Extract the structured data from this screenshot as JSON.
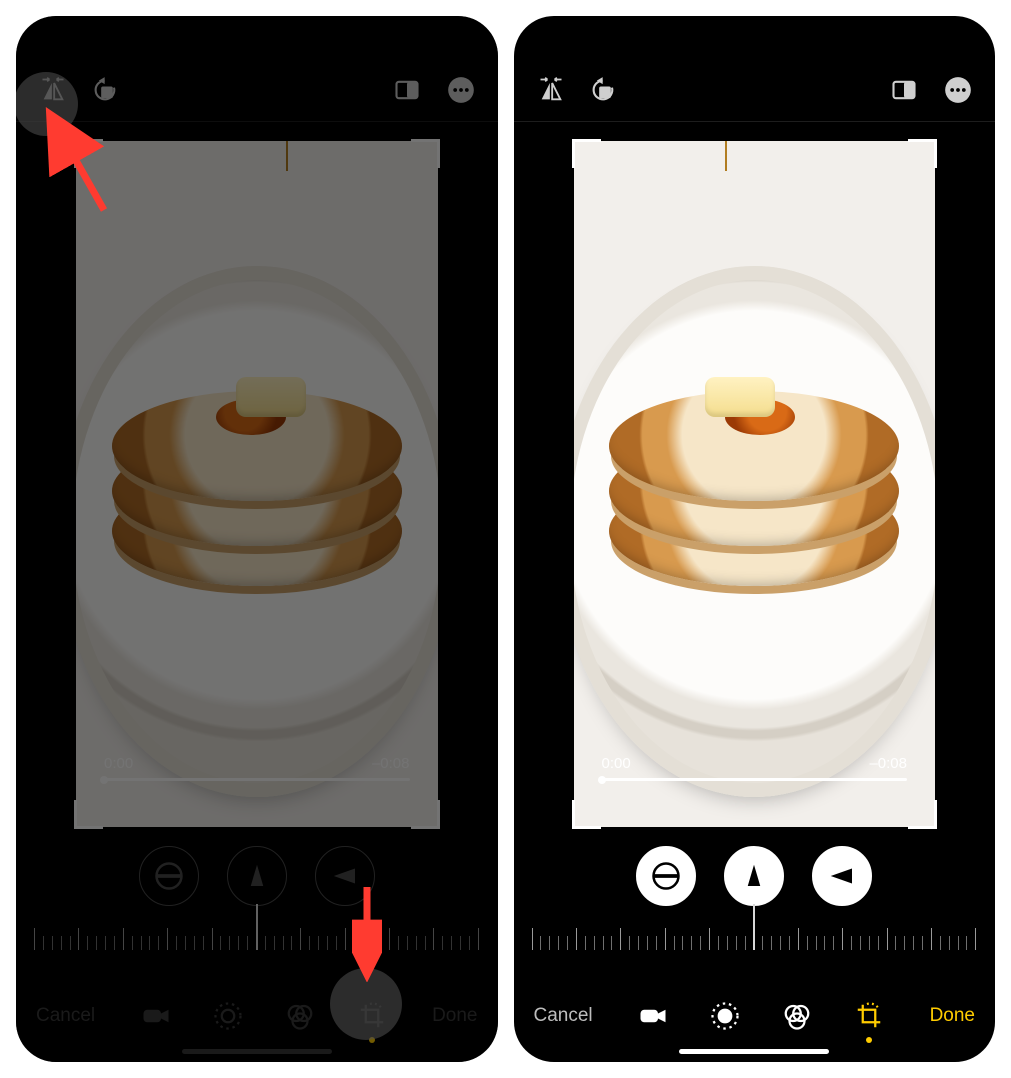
{
  "video": {
    "current_time": "0:00",
    "remaining_time": "–0:08"
  },
  "buttons": {
    "cancel": "Cancel",
    "done": "Done"
  },
  "top_icons": {
    "flip": "flip-horizontal-icon",
    "rotate": "rotate-ccw-icon",
    "aspect": "aspect-ratio-icon",
    "more": "more-icon"
  },
  "mid_controls": {
    "straighten": "straighten-icon",
    "vertical": "perspective-vertical-icon",
    "horizontal": "perspective-horizontal-icon"
  },
  "bottom_tools": {
    "video": "video-icon",
    "adjust": "adjust-icon",
    "filters": "filters-icon",
    "crop": "crop-rotate-icon"
  },
  "colors": {
    "accent": "#ffcc00",
    "annotation": "#ff3b30"
  },
  "annotation": {
    "left_target": "flip-button",
    "right_target": "crop-tool-button"
  }
}
